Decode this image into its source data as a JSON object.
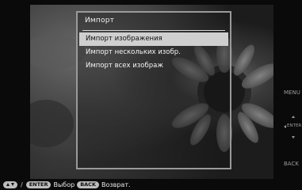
{
  "dialog": {
    "title": "Импорт",
    "items": [
      {
        "label": "Импорт изображения",
        "selected": true
      },
      {
        "label": "Импорт нескольких изобр.",
        "selected": false
      },
      {
        "label": "Импорт всех изображ",
        "selected": false
      }
    ]
  },
  "side_keys": {
    "menu": "MENU",
    "enter": "ENTER",
    "back": "BACK"
  },
  "guide": {
    "separator": "/",
    "enter_key": "ENTER",
    "enter_action": "Выбор",
    "back_key": "BACK",
    "back_action": "Возврат."
  }
}
